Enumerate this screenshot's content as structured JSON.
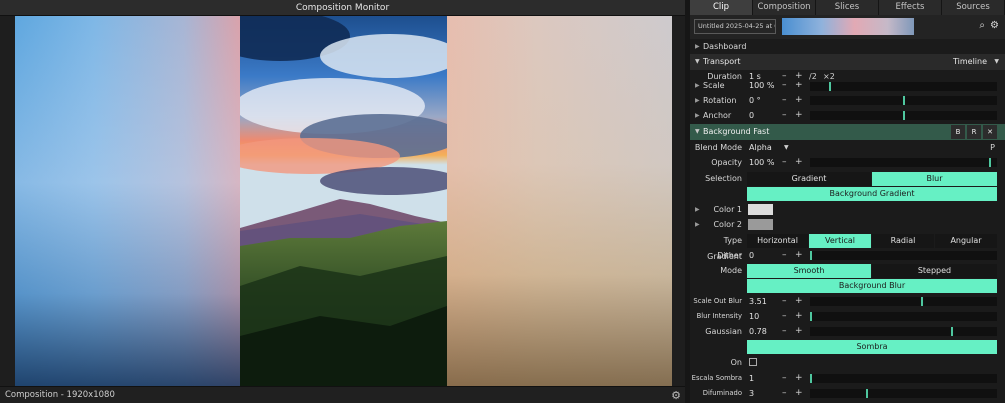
{
  "monitor": {
    "title": "Composition Monitor",
    "status": "Composition - 1920x1080"
  },
  "inspector": {
    "tabs": [
      {
        "label": "Clip",
        "active": true
      },
      {
        "label": "Composition",
        "active": false
      },
      {
        "label": "Slices",
        "active": false
      },
      {
        "label": "Effects",
        "active": false
      },
      {
        "label": "Sources",
        "active": false
      }
    ],
    "clip_name": "Untitled 2025-04-25 at 01.3...",
    "dashboard": "Dashboard",
    "transport": {
      "title": "Transport",
      "mode": "Timeline",
      "duration_label": "Duration",
      "duration_value": "1 s",
      "minus": "–",
      "plus": "+",
      "half": "/2",
      "double": "×2"
    },
    "scale": {
      "label": "Scale",
      "value": "100 %",
      "level": 0.1
    },
    "rotation": {
      "label": "Rotation",
      "value": "0 °",
      "level": 0.5
    },
    "anchor": {
      "label": "Anchor",
      "value": "0",
      "level": 0.5
    },
    "effect": {
      "title": "Background Fast",
      "btn_b": "B",
      "btn_r": "R",
      "btn_x": "✕",
      "blend_label": "Blend Mode",
      "blend_value": "Alpha",
      "blend_p": "P",
      "opacity_label": "Opacity",
      "opacity_value": "100 %",
      "opacity_level": 0.97,
      "selection_label": "Selection",
      "selection_options": [
        "Gradient",
        "Blur"
      ],
      "selection_active": "Blur",
      "section_gradient": "Background Gradient",
      "color1_label": "Color 1",
      "color1": "#dcdcdc",
      "color2_label": "Color 2",
      "color2": "#9a9a9a",
      "type_gradient_label": "Type Gradient",
      "type_gradient_options": [
        "Horizontal",
        "Vertical",
        "Radial",
        "Angular"
      ],
      "type_gradient_active": "Vertical",
      "dither_label": "Dither",
      "dither_value": "0",
      "dither_level": 0.0,
      "mode_label": "Mode",
      "mode_options": [
        "Smooth",
        "Stepped"
      ],
      "mode_active": "Smooth",
      "section_blur": "Background Blur",
      "scale_out_blur_label": "Scale Out Blur",
      "scale_out_blur_value": "3.51",
      "scale_out_blur_level": 0.6,
      "blur_intensity_label": "Blur Intensity",
      "blur_intensity_value": "10",
      "blur_intensity_level": 0.0,
      "gaussian_label": "Gaussian",
      "gaussian_value": "0.78",
      "gaussian_level": 0.76,
      "section_sombra": "Sombra",
      "on_label": "On",
      "escala_label": "Escala Sombra",
      "escala_value": "1",
      "escala_level": 0.0,
      "difuminado_label": "Difuminado",
      "difuminado_value": "3",
      "difuminado_level": 0.3
    }
  },
  "colors": {
    "accent": "#66f0c4",
    "slider_knob": "#4fc79f",
    "effect_header": "#335a4a",
    "panel_bg": "#1b1b1b"
  }
}
